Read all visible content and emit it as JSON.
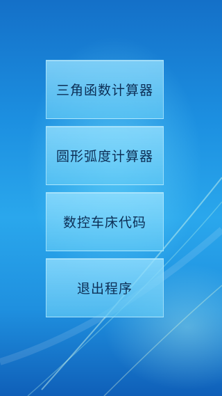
{
  "menu": {
    "items": [
      {
        "label": "三角函数计算器"
      },
      {
        "label": "圆形弧度计算器"
      },
      {
        "label": "数控车床代码"
      },
      {
        "label": "退出程序"
      }
    ]
  }
}
